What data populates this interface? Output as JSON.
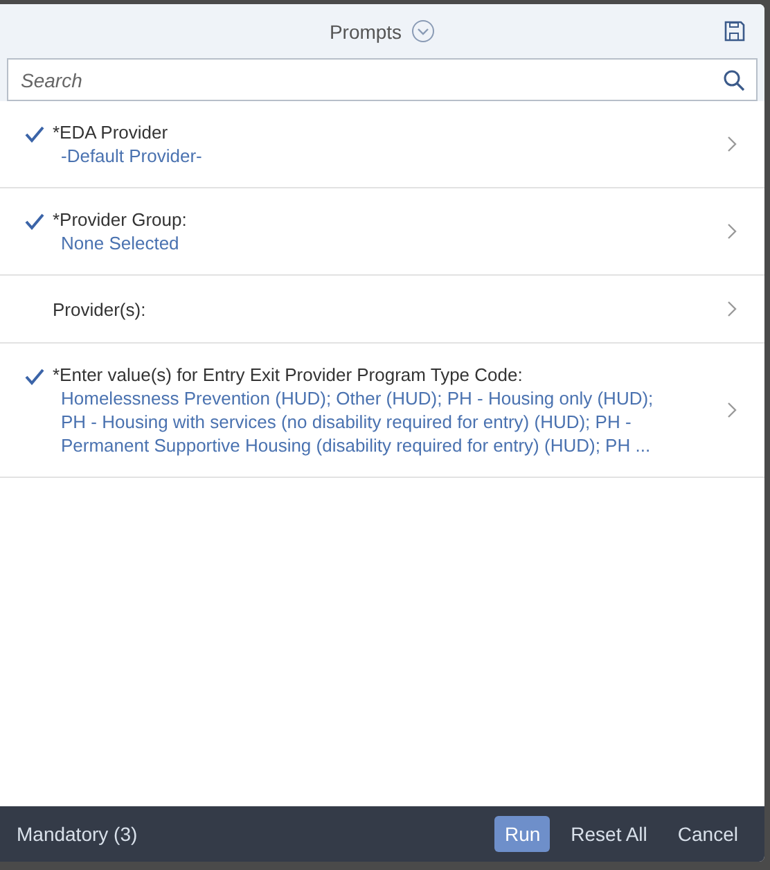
{
  "dialog": {
    "title": "Prompts"
  },
  "search": {
    "placeholder": "Search"
  },
  "prompts": [
    {
      "label": "*EDA Provider",
      "checked": true,
      "value_lines": [
        "-Default Provider-"
      ]
    },
    {
      "label": "*Provider Group:",
      "checked": true,
      "value_lines": [
        "None Selected"
      ]
    },
    {
      "label": "Provider(s):",
      "checked": false
    },
    {
      "label": "*Enter value(s) for Entry Exit Provider Program Type Code:",
      "checked": true,
      "value_lines": [
        "Homelessness Prevention (HUD); Other (HUD); PH - Housing only (HUD);",
        "PH - Housing with services (no disability required for entry) (HUD); PH -",
        "Permanent Supportive Housing (disability required for entry) (HUD); PH ..."
      ]
    }
  ],
  "footer": {
    "status": "Mandatory (3)",
    "buttons": [
      {
        "label": "Run",
        "kind": "primary"
      },
      {
        "label": "Reset All",
        "kind": "plain"
      },
      {
        "label": "Cancel",
        "kind": "plain"
      }
    ]
  }
}
